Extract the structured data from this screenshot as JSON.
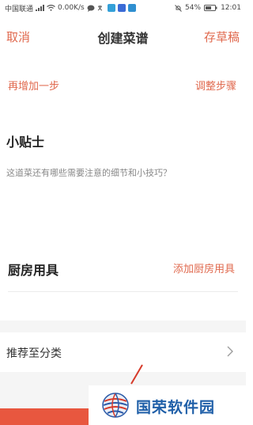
{
  "status_bar": {
    "carrier": "中国联通",
    "net_speed": "0.00K/s",
    "battery": "54%",
    "time": "12:01"
  },
  "top_bar": {
    "cancel": "取消",
    "title": "创建菜谱",
    "draft": "存草稿"
  },
  "steps": {
    "add_step": "再增加一步",
    "adjust_steps": "调整步骤"
  },
  "tips": {
    "title": "小贴士",
    "placeholder": "这道菜还有哪些需要注意的细节和小技巧？"
  },
  "tools": {
    "title": "厨房用具",
    "add": "添加厨房用具"
  },
  "category": {
    "label": "推荐至分类"
  },
  "watermark": {
    "text": "国荣软件园"
  },
  "colors": {
    "accent": "#e0694e",
    "watermark_blue": "#1f5fa8",
    "bottom_red": "#e8573f"
  }
}
